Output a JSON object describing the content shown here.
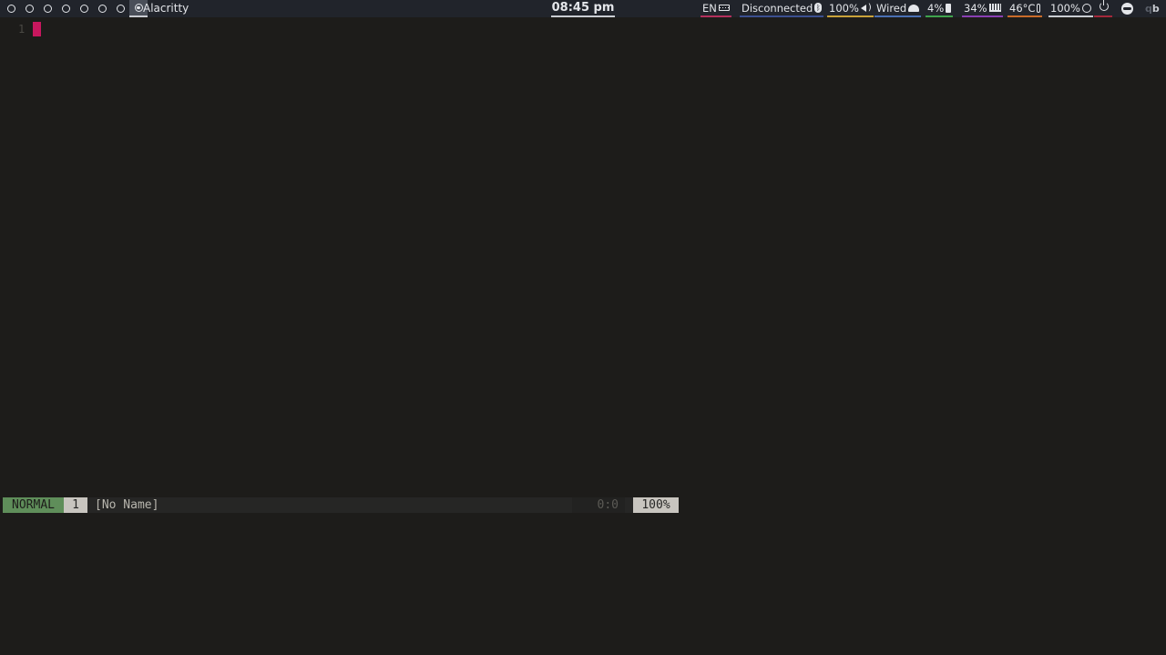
{
  "topbar": {
    "window_title": "Alacritty",
    "clock": "08:45 pm",
    "workspace_count": 7,
    "modules": {
      "keyboard": {
        "label": "EN",
        "icon": "keyboard-icon",
        "accent": "#b3305d"
      },
      "bluetooth": {
        "label": "Disconnected",
        "icon": "bluetooth-icon",
        "accent": "#3b4f8f"
      },
      "volume": {
        "label": "100%",
        "icon": "speaker-icon",
        "accent": "#c9a23a"
      },
      "network": {
        "label": "Wired",
        "icon": "ethernet-icon",
        "accent": "#4a6fb3"
      },
      "battery": {
        "label": "4%",
        "icon": "battery-icon",
        "accent": "#3fa34d"
      },
      "memory": {
        "label": "34%",
        "icon": "memory-icon",
        "accent": "#8a3fb3"
      },
      "temperature": {
        "label": "46°C",
        "icon": "thermometer-icon",
        "accent": "#c96b2a"
      },
      "brightness": {
        "label": "100%",
        "icon": "brightness-icon",
        "accent": "#c9ccd2"
      }
    },
    "power_icon": "power-icon",
    "power_accent": "#a3283b",
    "user_icon": "user-icon",
    "qb_text": "q",
    "qb_text_b": "b"
  },
  "editor": {
    "line_number": "1",
    "cursor_color": "#c8175e",
    "status": {
      "mode": "NORMAL",
      "mode_color": "#5f8e5a",
      "buffer_number": "1",
      "file_name": "[No Name]",
      "position": "0:0",
      "percent": "100%"
    }
  }
}
